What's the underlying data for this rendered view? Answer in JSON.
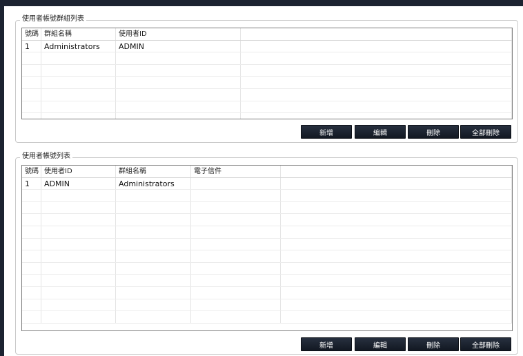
{
  "group_section": {
    "title": "使用者帳號群組列表",
    "columns": [
      "號碼",
      "群組名稱",
      "使用者ID",
      ""
    ],
    "rows": [
      [
        "1",
        "Administrators",
        "ADMIN",
        ""
      ],
      [
        "",
        "",
        "",
        ""
      ],
      [
        "",
        "",
        "",
        ""
      ],
      [
        "",
        "",
        "",
        ""
      ],
      [
        "",
        "",
        "",
        ""
      ],
      [
        "",
        "",
        "",
        ""
      ],
      [
        "",
        "",
        "",
        ""
      ]
    ],
    "buttons": {
      "add": "新增",
      "edit": "編輯",
      "delete": "刪除",
      "delete_all": "全部刪除"
    }
  },
  "user_section": {
    "title": "使用者帳號列表",
    "columns": [
      "號碼",
      "使用者ID",
      "群組名稱",
      "電子信件",
      ""
    ],
    "rows": [
      [
        "1",
        "ADMIN",
        "Administrators",
        "",
        ""
      ],
      [
        "",
        "",
        "",
        "",
        ""
      ],
      [
        "",
        "",
        "",
        "",
        ""
      ],
      [
        "",
        "",
        "",
        "",
        ""
      ],
      [
        "",
        "",
        "",
        "",
        ""
      ],
      [
        "",
        "",
        "",
        "",
        ""
      ],
      [
        "",
        "",
        "",
        "",
        ""
      ],
      [
        "",
        "",
        "",
        "",
        ""
      ],
      [
        "",
        "",
        "",
        "",
        ""
      ],
      [
        "",
        "",
        "",
        "",
        ""
      ],
      [
        "",
        "",
        "",
        "",
        ""
      ],
      [
        "",
        "",
        "",
        "",
        ""
      ]
    ],
    "buttons": {
      "add": "新增",
      "edit": "編輯",
      "delete": "刪除",
      "delete_all": "全部刪除"
    }
  }
}
